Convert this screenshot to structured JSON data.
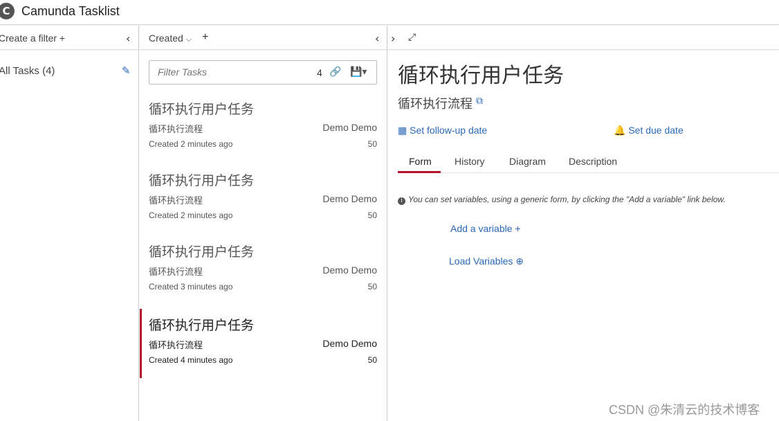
{
  "app": {
    "title": "Camunda Tasklist",
    "logo_letter": "C"
  },
  "filters": {
    "create_label": "Create a filter +",
    "items": [
      {
        "label": "All Tasks (4)"
      }
    ]
  },
  "list": {
    "sort_label": "Created",
    "search_placeholder": "Filter Tasks",
    "count": "4",
    "tasks": [
      {
        "name": "循环执行用户任务",
        "process": "循环执行流程",
        "assignee": "Demo Demo",
        "created": "Created 2 minutes ago",
        "priority": "50",
        "selected": false
      },
      {
        "name": "循环执行用户任务",
        "process": "循环执行流程",
        "assignee": "Demo Demo",
        "created": "Created 2 minutes ago",
        "priority": "50",
        "selected": false
      },
      {
        "name": "循环执行用户任务",
        "process": "循环执行流程",
        "assignee": "Demo Demo",
        "created": "Created 3 minutes ago",
        "priority": "50",
        "selected": false
      },
      {
        "name": "循环执行用户任务",
        "process": "循环执行流程",
        "assignee": "Demo Demo",
        "created": "Created 4 minutes ago",
        "priority": "50",
        "selected": true
      }
    ]
  },
  "detail": {
    "title": "循环执行用户任务",
    "process": "循环执行流程",
    "follow_up": "Set follow-up date",
    "due": "Set due date",
    "tabs": [
      "Form",
      "History",
      "Diagram",
      "Description"
    ],
    "info_text": "You can set variables, using a generic form, by clicking the \"Add a variable\" link below.",
    "add_variable": "Add a variable +",
    "load_variables": "Load Variables"
  },
  "watermark": "CSDN @朱清云的技术博客",
  "colors": {
    "accent": "#b5152b",
    "link": "#2a68b8"
  }
}
